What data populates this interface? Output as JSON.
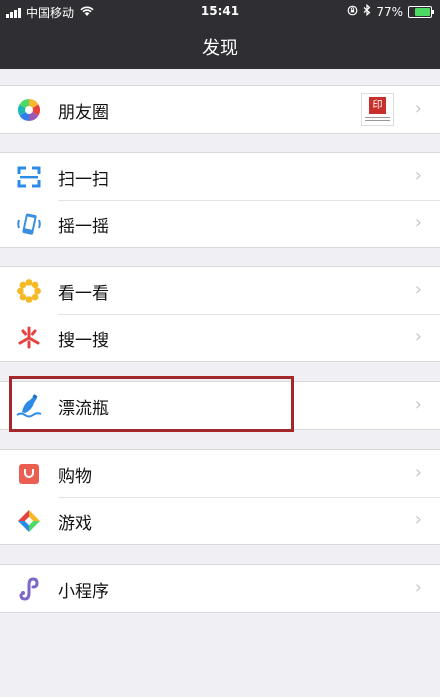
{
  "status_bar": {
    "carrier": "中国移动",
    "time": "15:41",
    "battery_percent": "77%",
    "battery_level": 0.77,
    "icons": [
      "signal-icon",
      "wifi-icon",
      "rotation-lock-icon",
      "bluetooth-icon",
      "battery-icon"
    ]
  },
  "nav": {
    "title": "发现"
  },
  "groups": [
    {
      "items": [
        {
          "id": "moments",
          "label": "朋友圈",
          "icon": "moments-icon"
        }
      ]
    },
    {
      "items": [
        {
          "id": "scan",
          "label": "扫一扫",
          "icon": "scan-icon"
        },
        {
          "id": "shake",
          "label": "摇一摇",
          "icon": "shake-icon"
        }
      ]
    },
    {
      "items": [
        {
          "id": "top-stories",
          "label": "看一看",
          "icon": "top-stories-icon"
        },
        {
          "id": "search",
          "label": "搜一搜",
          "icon": "search-icon"
        }
      ]
    },
    {
      "items": [
        {
          "id": "drift-bottle",
          "label": "漂流瓶",
          "icon": "drift-bottle-icon"
        }
      ]
    },
    {
      "items": [
        {
          "id": "shopping",
          "label": "购物",
          "icon": "shopping-icon"
        },
        {
          "id": "games",
          "label": "游戏",
          "icon": "games-icon"
        }
      ]
    },
    {
      "items": [
        {
          "id": "mini-programs",
          "label": "小程序",
          "icon": "mini-programs-icon"
        }
      ]
    }
  ],
  "colors": {
    "nav_background": "#2e2e33",
    "page_background": "#efeff4",
    "highlight_border": "#a3282c",
    "battery_fill": "#4cd964"
  }
}
